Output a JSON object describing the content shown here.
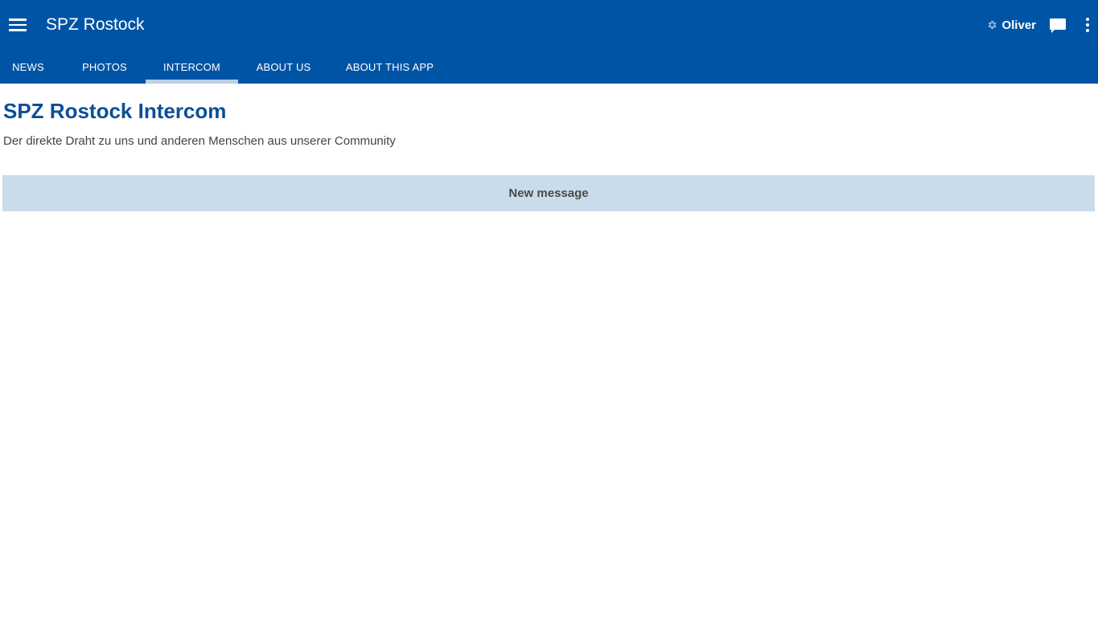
{
  "app": {
    "title": "SPZ Rostock",
    "user_name": "Oliver"
  },
  "icons": {
    "menu": "hamburger-menu-icon",
    "settings": "gear-icon",
    "chat": "chat-bubble-icon",
    "more": "more-vert-icon"
  },
  "colors": {
    "app_bar": "#0054a6",
    "tab_indicator": "#b9cfe6",
    "title_text": "#0a4f96",
    "button_bg": "#cadcec"
  },
  "tabs": [
    {
      "label": "NEWS",
      "active": false
    },
    {
      "label": "PHOTOS",
      "active": false
    },
    {
      "label": "INTERCOM",
      "active": true
    },
    {
      "label": "ABOUT US",
      "active": false
    },
    {
      "label": "ABOUT THIS APP",
      "active": false
    }
  ],
  "content": {
    "title": "SPZ Rostock Intercom",
    "subtitle": "Der direkte Draht zu uns und anderen Menschen aus unserer Community",
    "new_message_label": "New message"
  }
}
